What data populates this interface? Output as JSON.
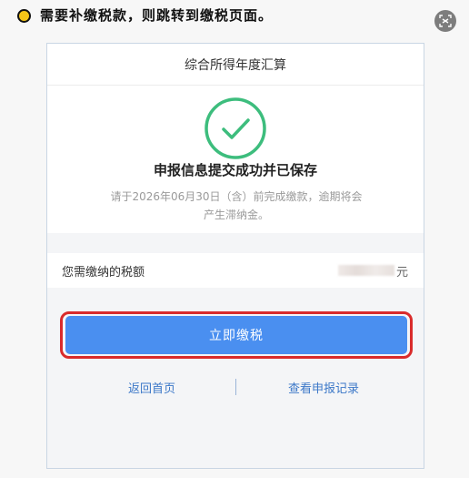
{
  "instruction": {
    "text": "需要补缴税款，则跳转到缴税页面。"
  },
  "phone": {
    "header_title": "综合所得年度汇算",
    "success_title": "申报信息提交成功并已保存",
    "notice_line1": "请于2026年06月30日（含）前完成缴款，逾期将会",
    "notice_line2": "产生滞纳金。",
    "amount_label": "您需缴纳的税额",
    "amount_unit": "元",
    "pay_button_label": "立即缴税",
    "link_home": "返回首页",
    "link_records": "查看申报记录"
  },
  "colors": {
    "accent_blue": "#4a8ff0",
    "success_green": "#3dbd7d",
    "highlight_red": "#d92b2b",
    "link_blue": "#3c78c8"
  },
  "icons": {
    "bullet": "circle-bullet-icon",
    "scan": "scan-icon",
    "success": "check-circle-icon"
  }
}
